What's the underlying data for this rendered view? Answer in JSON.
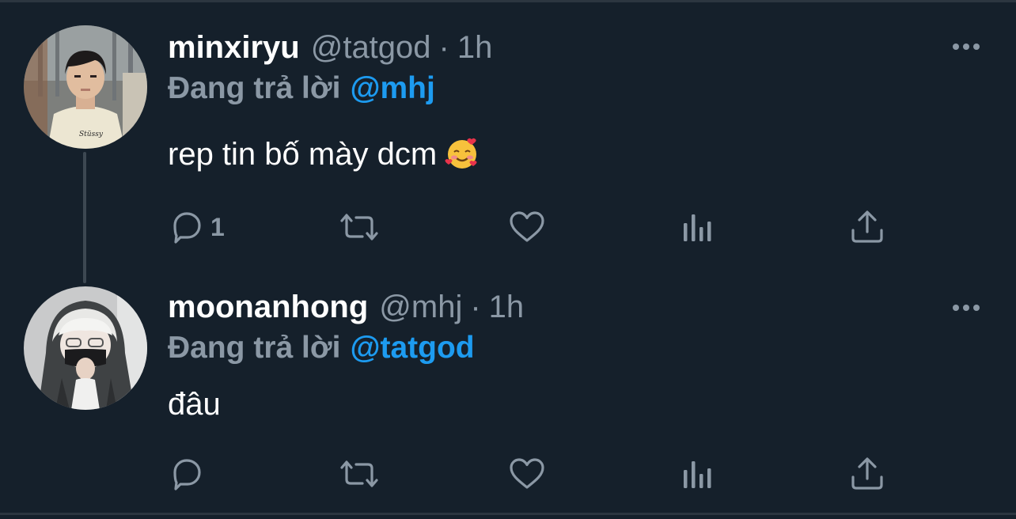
{
  "colors": {
    "background": "#15202b",
    "text_primary": "#ffffff",
    "text_secondary": "#8b98a5",
    "mention": "#1d9bf0"
  },
  "tweets": [
    {
      "display_name": "minxiryu",
      "handle": "@tatgod",
      "separator": "·",
      "time": "1h",
      "reply_prefix": "Đang trả lời",
      "reply_to": "@mhj",
      "text": "rep tin bố mày dcm",
      "emoji": "smiling-face-with-hearts-icon",
      "reply_count": "1",
      "retweet_count": "",
      "like_count": ""
    },
    {
      "display_name": "moonanhong",
      "handle": "@mhj",
      "separator": "·",
      "time": "1h",
      "reply_prefix": "Đang trả lời",
      "reply_to": "@tatgod",
      "text": "đâu",
      "reply_count": "",
      "retweet_count": "",
      "like_count": ""
    }
  ]
}
